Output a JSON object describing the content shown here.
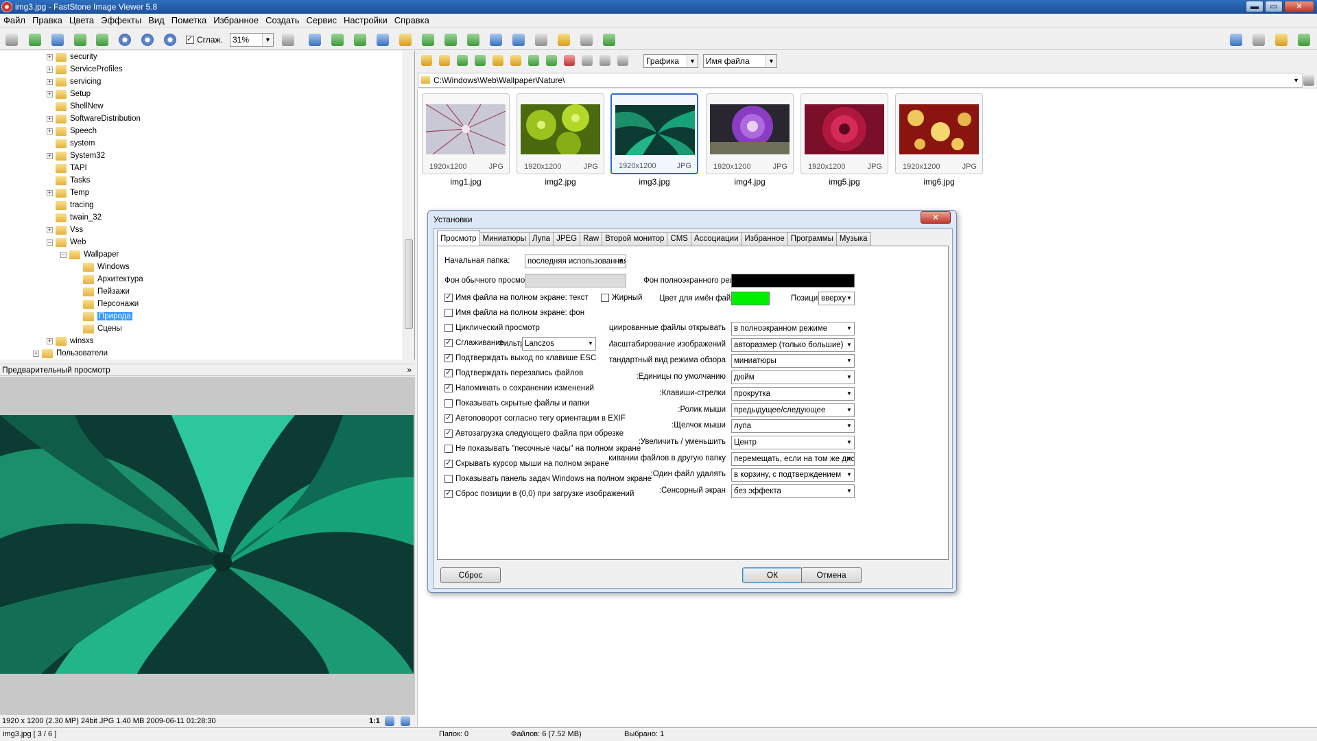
{
  "window": {
    "title": "img3.jpg - FastStone Image Viewer 5.8",
    "min": "▬",
    "max": "▭",
    "close": "✕"
  },
  "menu": [
    "Файл",
    "Правка",
    "Цвета",
    "Эффекты",
    "Вид",
    "Пометка",
    "Избранное",
    "Создать",
    "Сервис",
    "Настройки",
    "Справка"
  ],
  "toolbar": {
    "smooth_label": "Сглаж.",
    "zoom": "31%"
  },
  "tree": [
    {
      "label": "security",
      "level": 1,
      "exp": "+"
    },
    {
      "label": "ServiceProfiles",
      "level": 1,
      "exp": "+"
    },
    {
      "label": "servicing",
      "level": 1,
      "exp": "+"
    },
    {
      "label": "Setup",
      "level": 1,
      "exp": "+"
    },
    {
      "label": "ShellNew",
      "level": 1,
      "exp": ""
    },
    {
      "label": "SoftwareDistribution",
      "level": 1,
      "exp": "+"
    },
    {
      "label": "Speech",
      "level": 1,
      "exp": "+"
    },
    {
      "label": "system",
      "level": 1,
      "exp": ""
    },
    {
      "label": "System32",
      "level": 1,
      "exp": "+"
    },
    {
      "label": "TAPI",
      "level": 1,
      "exp": ""
    },
    {
      "label": "Tasks",
      "level": 1,
      "exp": ""
    },
    {
      "label": "Temp",
      "level": 1,
      "exp": "+"
    },
    {
      "label": "tracing",
      "level": 1,
      "exp": ""
    },
    {
      "label": "twain_32",
      "level": 1,
      "exp": ""
    },
    {
      "label": "Vss",
      "level": 1,
      "exp": "+"
    },
    {
      "label": "Web",
      "level": 1,
      "exp": "−"
    },
    {
      "label": "Wallpaper",
      "level": 2,
      "exp": "−"
    },
    {
      "label": "Windows",
      "level": 3,
      "exp": ""
    },
    {
      "label": "Архитектура",
      "level": 3,
      "exp": ""
    },
    {
      "label": "Пейзажи",
      "level": 3,
      "exp": ""
    },
    {
      "label": "Персонажи",
      "level": 3,
      "exp": ""
    },
    {
      "label": "Природа",
      "level": 3,
      "exp": "",
      "selected": true
    },
    {
      "label": "Сцены",
      "level": 3,
      "exp": ""
    },
    {
      "label": "winsxs",
      "level": 1,
      "exp": "+"
    },
    {
      "label": "Пользователи",
      "level": 0,
      "exp": "+"
    }
  ],
  "preview": {
    "header": "Предварительный просмотр",
    "collapse": "»",
    "info": "1920 x 1200 (2.30 MP)  24bit  JPG  1.40 MB  2009-06-11 01:28:30",
    "ratio": "1:1"
  },
  "browser": {
    "sort_filter": "Графика",
    "sort_by": "Имя файла",
    "path": "C:\\Windows\\Web\\Wallpaper\\Nature\\",
    "thumbs": [
      {
        "name": "img1.jpg",
        "dims": "1920x1200",
        "ext": "JPG"
      },
      {
        "name": "img2.jpg",
        "dims": "1920x1200",
        "ext": "JPG"
      },
      {
        "name": "img3.jpg",
        "dims": "1920x1200",
        "ext": "JPG",
        "selected": true
      },
      {
        "name": "img4.jpg",
        "dims": "1920x1200",
        "ext": "JPG"
      },
      {
        "name": "img5.jpg",
        "dims": "1920x1200",
        "ext": "JPG"
      },
      {
        "name": "img6.jpg",
        "dims": "1920x1200",
        "ext": "JPG"
      }
    ]
  },
  "status": {
    "file": "img3.jpg [ 3 / 6 ]",
    "folders": "Папок: 0",
    "files": "Файлов: 6 (7.52 MB)",
    "selected": "Выбрано: 1"
  },
  "dialog": {
    "title": "Установки",
    "close": "✕",
    "tabs": [
      "Просмотр",
      "Миниатюры",
      "Лупа",
      "JPEG",
      "Raw",
      "Второй монитор",
      "CMS",
      "Ассоциации",
      "Избранное",
      "Программы",
      "Музыка"
    ],
    "start_folder_label": "Начальная папка:",
    "start_folder_value": "последняя использованная",
    "normal_bg_label": "Фон обычного просмотра:",
    "fullscreen_bg_label": "Фон полноэкранного режима:",
    "fullscreen_bg_color": "#000000",
    "name_color_label": "Цвет для имён файлов:",
    "name_color": "#00ee00",
    "bold_label": "Жирный",
    "position_label": "Позиция:",
    "position_value": "вверху",
    "filter_label": "Фильтр:",
    "filter_value": "Lanczos",
    "checks": [
      {
        "label": "Имя файла на полном экране: текст",
        "checked": true
      },
      {
        "label": "Имя файла на полном экране: фон",
        "checked": false
      },
      {
        "label": "Циклический просмотр",
        "checked": false
      },
      {
        "label": "Сглаживание",
        "checked": true
      },
      {
        "label": "Подтверждать выход по клавише ESC",
        "checked": true
      },
      {
        "label": "Подтверждать перезапись файлов",
        "checked": true
      },
      {
        "label": "Напоминать о сохранении изменений",
        "checked": true
      },
      {
        "label": "Показывать скрытые файлы и папки",
        "checked": false
      },
      {
        "label": "Автоповорот согласно тегу ориентации в EXIF",
        "checked": true
      },
      {
        "label": "Автозагрузка следующего файла при обрезке",
        "checked": true
      },
      {
        "label": "Не показывать \"песочные часы\" на полном экране",
        "checked": false
      },
      {
        "label": "Скрывать курсор мыши на полном экране",
        "checked": true
      },
      {
        "label": "Показывать панель задач Windows на полном экране",
        "checked": false
      },
      {
        "label": "Сброс позиции в (0,0) при загрузке изображений",
        "checked": true
      }
    ],
    "options": [
      {
        "label": "Ассоциированные файлы открывать:",
        "value": "в полноэкранном режиме"
      },
      {
        "label": "Масштабирование изображений:",
        "value": "авторазмер (только большие)"
      },
      {
        "label": "Стандартный вид режима обзора:",
        "value": "миниатюры"
      },
      {
        "label": "Единицы по умолчанию:",
        "value": "дюйм"
      },
      {
        "label": "Клавиши-стрелки:",
        "value": "прокрутка"
      },
      {
        "label": "Ролик мыши:",
        "value": "предыдущее/следующее"
      },
      {
        "label": "Щелчок мыши:",
        "value": "лупа"
      },
      {
        "label": "Увеличить / уменьшить:",
        "value": "Центр"
      },
      {
        "label": "ретаскивании файлов в другую папку:",
        "value": "перемещать, если на том же диске"
      },
      {
        "label": "Один файл удалять:",
        "value": "в корзину, с подтверждением"
      },
      {
        "label": "Сенсорный экран:",
        "value": "без эффекта"
      }
    ],
    "reset_button": "Сброс",
    "ok_button": "ОК",
    "cancel_button": "Отмена"
  }
}
